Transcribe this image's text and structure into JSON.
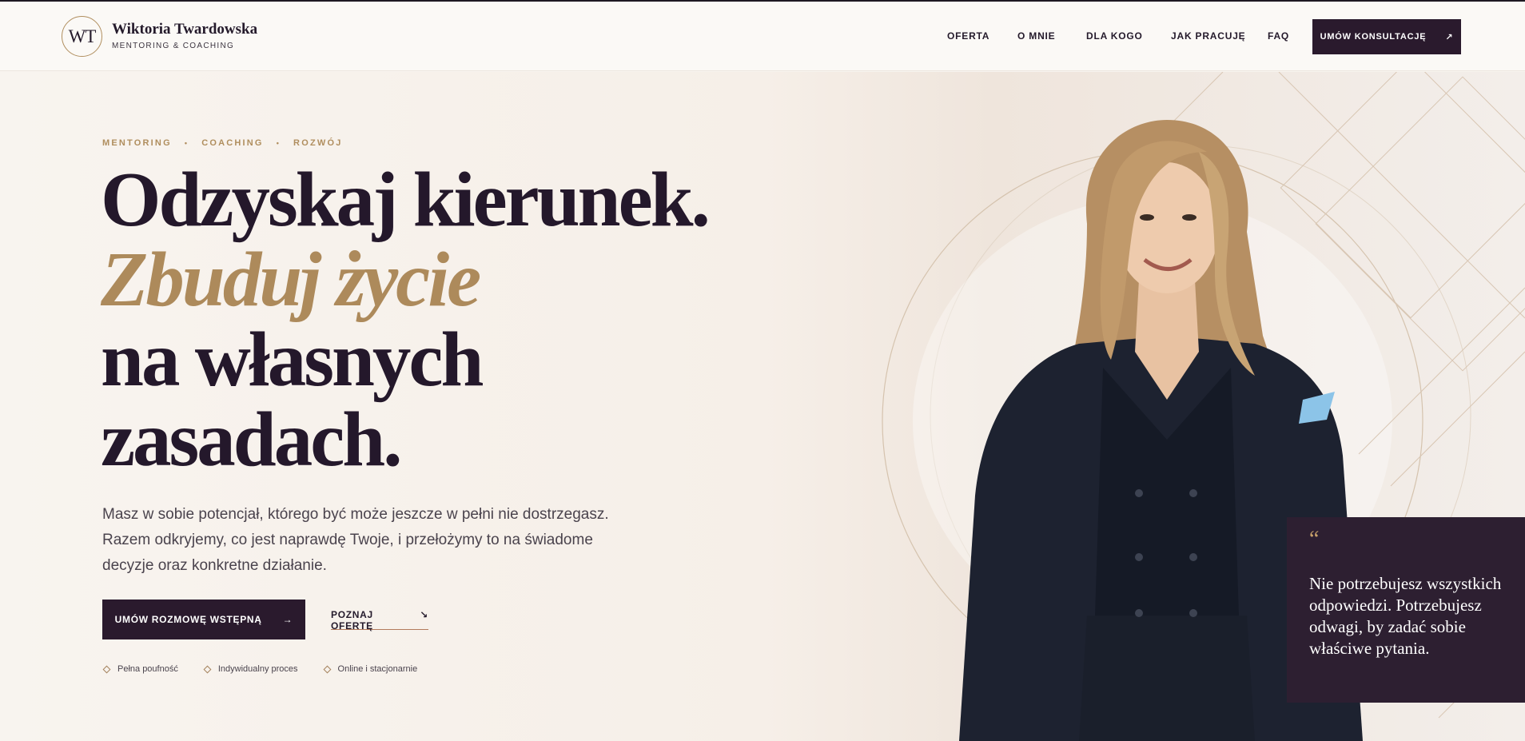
{
  "brand": {
    "monogram": "WT",
    "name": "Wiktoria Twardowska",
    "tagline": "MENTORING & COACHING"
  },
  "nav": {
    "items": [
      {
        "label": "OFERTA"
      },
      {
        "label": "O MNIE"
      },
      {
        "label": "DLA KOGO"
      },
      {
        "label": "JAK PRACUJĘ"
      },
      {
        "label": "FAQ"
      }
    ],
    "cta_label": "UMÓW KONSULTACJĘ",
    "cta_icon": "↗"
  },
  "hero": {
    "eyebrow": [
      "MENTORING",
      "COACHING",
      "ROZWÓJ"
    ],
    "eyebrow_separator": "•",
    "headline": {
      "line1": "Odzyskaj kierunek.",
      "line2": "Zbuduj życie",
      "line3": "na własnych",
      "line4": "zasadach."
    },
    "lead": "Masz w sobie potencjał, którego być może jeszcze w pełni nie dostrzegasz. Razem odkryjemy, co jest naprawdę Twoje, i przełożymy to na świadome decyzje oraz konkretne działanie.",
    "primary_button": {
      "label": "UMÓW ROZMOWĘ WSTĘPNĄ",
      "icon": "→"
    },
    "secondary_link": {
      "label": "POZNAJ OFERTĘ",
      "icon": "↘"
    },
    "features": [
      "Pełna poufność",
      "Indywidualny proces",
      "Online i stacjonarnie"
    ],
    "quote": {
      "mark": "“",
      "text": "Nie potrzebujesz wszystkich odpowiedzi. Potrzebujesz odwagi, by zadać sobie właściwe pytania."
    }
  },
  "colors": {
    "accent_gold": "#b08e5e",
    "dark_plum": "#2a1a2d",
    "background": "#f8f4ef"
  }
}
